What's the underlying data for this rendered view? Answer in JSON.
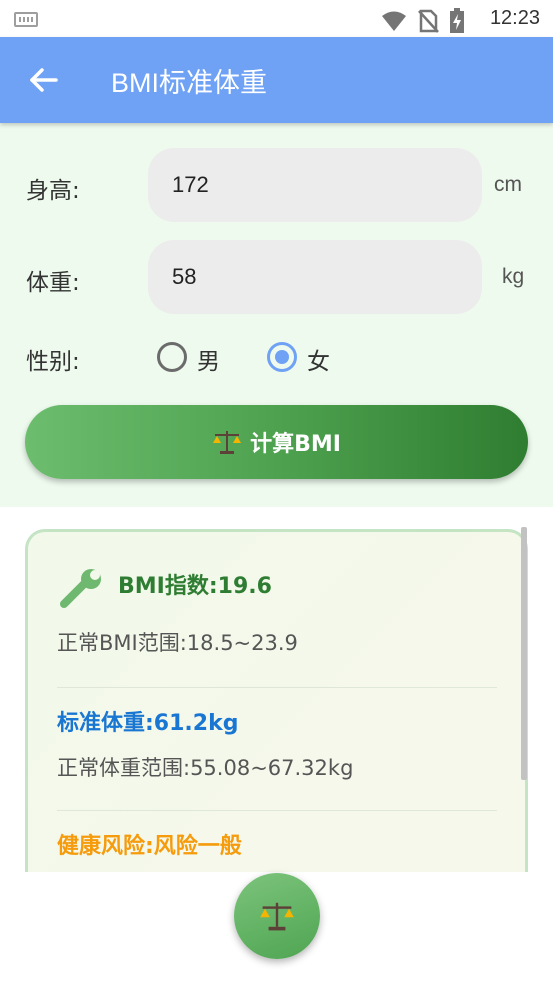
{
  "status_bar": {
    "time": "12:23",
    "icons": [
      "keyboard-icon",
      "wifi-icon",
      "no-sim-icon",
      "battery-charging-icon"
    ]
  },
  "app_bar": {
    "title": "BMI标准体重",
    "back_icon": "arrow-left-icon",
    "background": "#6fa2f4"
  },
  "form": {
    "height_label": "身高:",
    "height_value": "172",
    "height_unit": "cm",
    "weight_label": "体重:",
    "weight_value": "58",
    "weight_unit": "kg",
    "gender_label": "性别:",
    "gender_options": [
      {
        "label": "男",
        "selected": false
      },
      {
        "label": "女",
        "selected": true
      }
    ],
    "calculate_label": "计算BMI",
    "calculate_icon": "scale-icon"
  },
  "result": {
    "bmi_title": "BMI指数:19.6",
    "bmi_range": "正常BMI范围:18.5~23.9",
    "standard_weight_title": "标准体重:61.2kg",
    "weight_range": "正常体重范围:55.08~67.32kg",
    "risk_title": "健康风险:风险一般",
    "colors": {
      "bmi": "#2e7d32",
      "weight": "#1976d2",
      "risk": "#f59b0c"
    }
  },
  "fab": {
    "icon": "scale-icon"
  }
}
